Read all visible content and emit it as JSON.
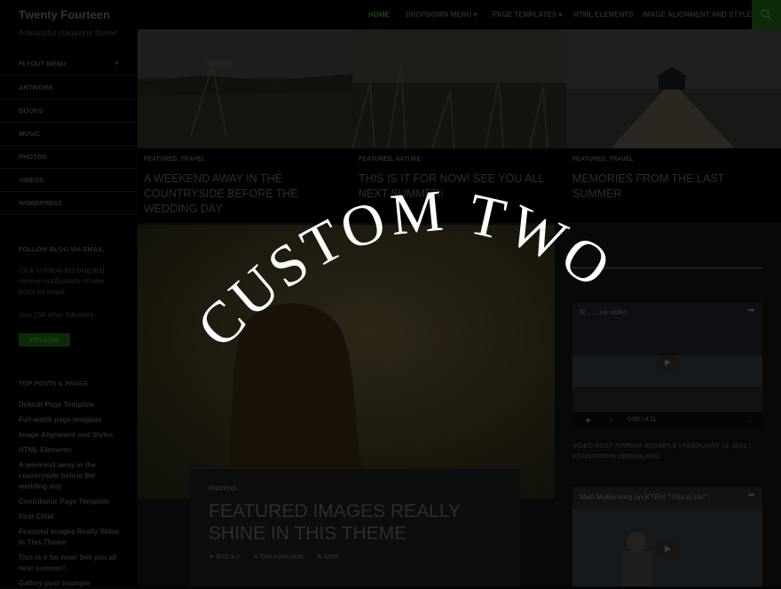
{
  "site": {
    "title": "Twenty Fourteen",
    "tagline": "A beautiful magazine theme"
  },
  "nav": {
    "items": [
      "HOME",
      "DROPDOWN MENU",
      "PAGE TEMPLATES",
      "HTML ELEMENTS",
      "IMAGE ALIGNMENT AND STYLES"
    ],
    "search_icon": "search-icon"
  },
  "sidebar": {
    "menu": [
      "FLYOUT MENU",
      "ARTWORK",
      "BOOKS",
      "MUSIC",
      "PHOTOS",
      "VIDEOS",
      "WORDPRESS"
    ],
    "follow_title": "FOLLOW BLOG VIA EMAIL",
    "follow_text": "Click to follow this blog and receive notifications of new posts by email.",
    "followers": "Join 156 other followers",
    "follow_button": "FOLLOW",
    "top_title": "TOP POSTS & PAGES",
    "top_links": [
      "Default Page Template",
      "Full-width page template",
      "Image Alignment and Styles",
      "HTML Elements",
      "A weekend away in the countryside before the wedding day",
      "Contributor Page Template",
      "First Child",
      "Featured Images Really Shine In This Theme",
      "This is it for now! See you all next summer!",
      "Gallery post example"
    ]
  },
  "featured": [
    {
      "cats": "FEATURED, TRAVEL",
      "title": "A WEEKEND AWAY IN THE COUNTRYSIDE BEFORE THE WEDDING DAY"
    },
    {
      "cats": "FEATURED, NATURE",
      "title": "THIS IS IT FOR NOW! SEE YOU ALL NEXT SUMMER!"
    },
    {
      "cats": "FEATURED, TRAVEL",
      "title": "MEMORIES FROM THE LAST SUMMER"
    }
  ],
  "post": {
    "category": "PHOTOS",
    "title": "FEATURED IMAGES REALLY SHINE IN THIS THEME",
    "meta": [
      "STICKY",
      "TAKASHI IRIE",
      "EDIT"
    ]
  },
  "videos": [
    {
      "title": "N... ...ss video",
      "time": "0:00 / 4:11"
    },
    {
      "title": "Matt Mullenweg on KTEH \"This is Us!\""
    }
  ],
  "video_caption": "VIDEO POST FORMAT EXAMPLE | FEBRUARY 13, 2013 | KONSTANTIN OBRENLAND",
  "overlay": {
    "text": "CUSTOM TWO"
  },
  "colors": {
    "accent": "#24890d",
    "overlay_text": "#ffffff",
    "background": "#000000"
  }
}
